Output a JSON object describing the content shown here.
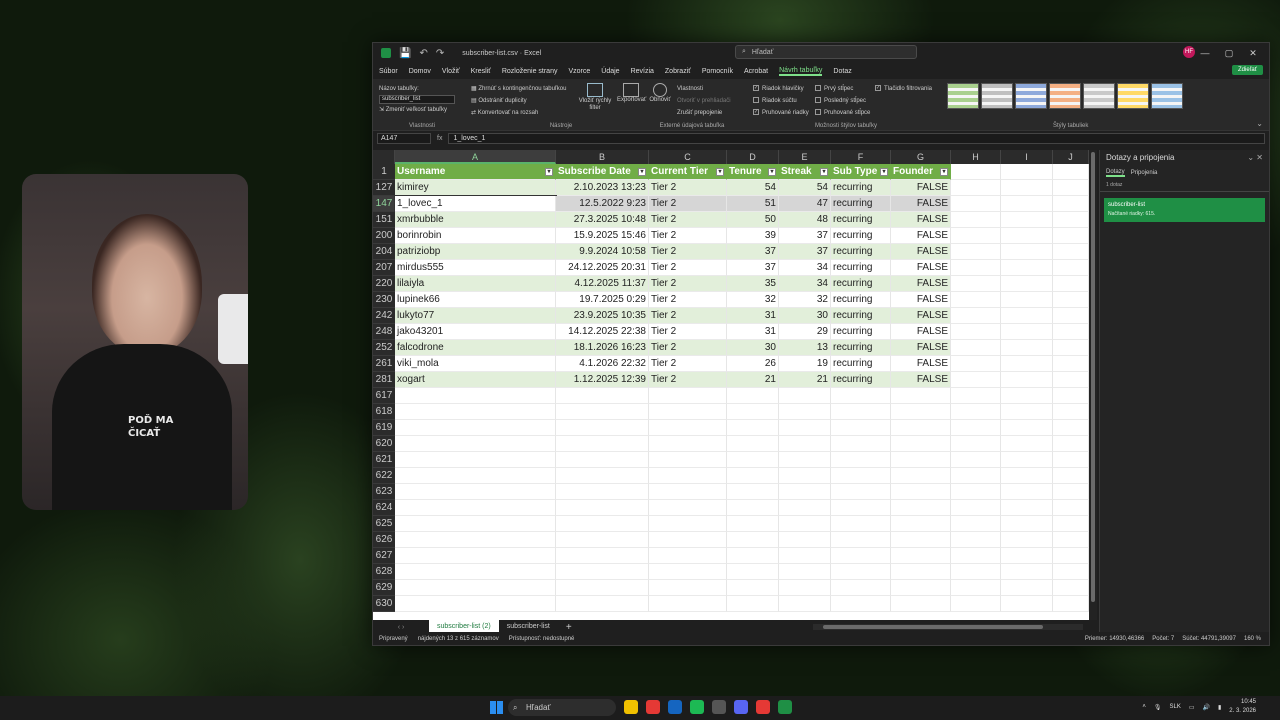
{
  "webcam": {
    "shirt_text": "POĎ MA ČICAŤ"
  },
  "window": {
    "title": "subscriber-list.csv · Excel",
    "search_placeholder": "Hľadať",
    "avatar_initials": "HF",
    "controls": [
      "—",
      "▢",
      "✕"
    ]
  },
  "menu": {
    "items": [
      "Súbor",
      "Domov",
      "Vložiť",
      "Kresliť",
      "Rozloženie strany",
      "Vzorce",
      "Údaje",
      "Revízia",
      "Zobraziť",
      "Pomocník",
      "Acrobat",
      "Návrh tabuľky",
      "Dotaz"
    ],
    "active": "Návrh tabuľky",
    "share": "Zdieľať"
  },
  "ribbon": {
    "props": {
      "table_name_label": "Názov tabuľky:",
      "table_name_value": "subscriber_list",
      "resize": "Zmeniť veľkosť tabuľky",
      "group": "Vlastnosti"
    },
    "tools": {
      "pivot": "Zhrnúť s kontingenčnou tabuľkou",
      "dupes": "Odstrániť duplicity",
      "convert": "Konvertovať na rozsah",
      "slicer": "Vložiť rýchly filter",
      "group": "Nástroje"
    },
    "external": {
      "export": "Exportovať",
      "refresh": "Obnoviť",
      "properties": "Vlastnosti",
      "open_browser": "Otvoriť v prehliadači",
      "unlink": "Zrušiť prepojenie",
      "group": "Externé údajová tabuľka"
    },
    "style_options": {
      "header_row": "Riadok hlavičky",
      "total_row": "Riadok súčtu",
      "banded_rows": "Pruhované riadky",
      "first_col": "Prvý stĺpec",
      "last_col": "Posledný stĺpec",
      "banded_cols": "Pruhované stĺpce",
      "filter_btn": "Tlačidlo filtrovania",
      "group": "Možnosti štýlov tabuľky"
    },
    "styles_group": "Štýly tabuliek",
    "style_colors": [
      "#a9d08e",
      "#bfbfbf",
      "#8ea9db",
      "#f4b084",
      "#c9c9c9",
      "#ffd966",
      "#9bc2e6"
    ]
  },
  "formula_bar": {
    "name_box": "A147",
    "fx": "fx",
    "value": "1_lovec_1"
  },
  "columns": [
    "A",
    "B",
    "C",
    "D",
    "E",
    "F",
    "G",
    "H",
    "I",
    "J"
  ],
  "table": {
    "headers": [
      "Username",
      "Subscribe Date",
      "Current Tier",
      "Tenure",
      "Streak",
      "Sub Type",
      "Founder"
    ],
    "rows": [
      {
        "rn": "127",
        "cells": [
          "kimirey",
          "2.10.2023 13:23",
          "Tier 2",
          "54",
          "54",
          "recurring",
          "FALSE"
        ]
      },
      {
        "rn": "147",
        "cells": [
          "1_lovec_1",
          "12.5.2022 9:23",
          "Tier 2",
          "51",
          "47",
          "recurring",
          "FALSE"
        ]
      },
      {
        "rn": "151",
        "cells": [
          "xmrbubble",
          "27.3.2025 10:48",
          "Tier 2",
          "50",
          "48",
          "recurring",
          "FALSE"
        ]
      },
      {
        "rn": "200",
        "cells": [
          "borinrobin",
          "15.9.2025 15:46",
          "Tier 2",
          "39",
          "37",
          "recurring",
          "FALSE"
        ]
      },
      {
        "rn": "204",
        "cells": [
          "patriziobp",
          "9.9.2024 10:58",
          "Tier 2",
          "37",
          "37",
          "recurring",
          "FALSE"
        ]
      },
      {
        "rn": "207",
        "cells": [
          "mirdus555",
          "24.12.2025 20:31",
          "Tier 2",
          "37",
          "34",
          "recurring",
          "FALSE"
        ]
      },
      {
        "rn": "220",
        "cells": [
          "lilaiyla",
          "4.12.2025 11:37",
          "Tier 2",
          "35",
          "34",
          "recurring",
          "FALSE"
        ]
      },
      {
        "rn": "230",
        "cells": [
          "lupinek66",
          "19.7.2025 0:29",
          "Tier 2",
          "32",
          "32",
          "recurring",
          "FALSE"
        ]
      },
      {
        "rn": "242",
        "cells": [
          "lukyto77",
          "23.9.2025 10:35",
          "Tier 2",
          "31",
          "30",
          "recurring",
          "FALSE"
        ]
      },
      {
        "rn": "248",
        "cells": [
          "jako43201",
          "14.12.2025 22:38",
          "Tier 2",
          "31",
          "29",
          "recurring",
          "FALSE"
        ]
      },
      {
        "rn": "252",
        "cells": [
          "falcodrone",
          "18.1.2026 16:23",
          "Tier 2",
          "30",
          "13",
          "recurring",
          "FALSE"
        ]
      },
      {
        "rn": "261",
        "cells": [
          "viki_mola",
          "4.1.2026 22:32",
          "Tier 2",
          "26",
          "19",
          "recurring",
          "FALSE"
        ]
      },
      {
        "rn": "281",
        "cells": [
          "xogart",
          "1.12.2025 12:39",
          "Tier 2",
          "21",
          "21",
          "recurring",
          "FALSE"
        ]
      }
    ],
    "empty_rows": [
      "617",
      "618",
      "619",
      "620",
      "621",
      "622",
      "623",
      "624",
      "625",
      "626",
      "627",
      "628",
      "629",
      "630"
    ]
  },
  "sheets": {
    "tabs": [
      "subscriber-list (2)",
      "subscriber-list"
    ],
    "active": 0
  },
  "status": {
    "ready": "Pripravený",
    "found": "nájdených 13 z 615 záznamov",
    "accessibility": "Prístupnosť: nedostupné",
    "average": "Priemer: 14930,46366",
    "count": "Počet: 7",
    "sum": "Súčet: 44791,39097",
    "zoom": "160 %"
  },
  "queries_pane": {
    "title": "Dotazy a pripojenia",
    "tabs": [
      "Dotazy",
      "Pripojenia"
    ],
    "count": "1 dotaz",
    "item_name": "subscriber-list",
    "item_detail": "Načítané riadky: 615."
  },
  "taskbar": {
    "search": "Hľadať",
    "app_colors": [
      "#f0c000",
      "#e53935",
      "#1565c0",
      "#1db954",
      "#555555",
      "#5865f2",
      "#e53935",
      "#1f8f45"
    ],
    "lang": "SLK",
    "time": "10:45",
    "date": "2. 3. 2026"
  }
}
